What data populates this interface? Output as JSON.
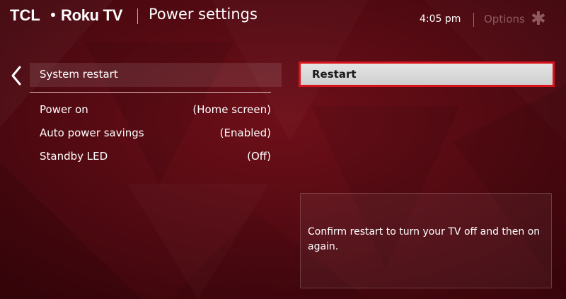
{
  "header": {
    "brand_tcl": "TCL",
    "brand_roku": "Roku TV",
    "page_title": "Power settings",
    "time": "4:05 pm",
    "options_label": "Options",
    "options_icon": "asterisk-icon"
  },
  "menu": {
    "back_icon": "chevron-left-icon",
    "selected_item": "System restart",
    "items": [
      {
        "label": "Power on",
        "value": "(Home screen)"
      },
      {
        "label": "Auto power savings",
        "value": "(Enabled)"
      },
      {
        "label": "Standby LED",
        "value": "(Off)"
      }
    ]
  },
  "action": {
    "restart_label": "Restart"
  },
  "info": {
    "text": "Confirm restart to turn your TV off and then on again."
  },
  "colors": {
    "background": "#5a0a12",
    "focus_border": "#d8131c",
    "button_fill": "#dcdcdc"
  }
}
